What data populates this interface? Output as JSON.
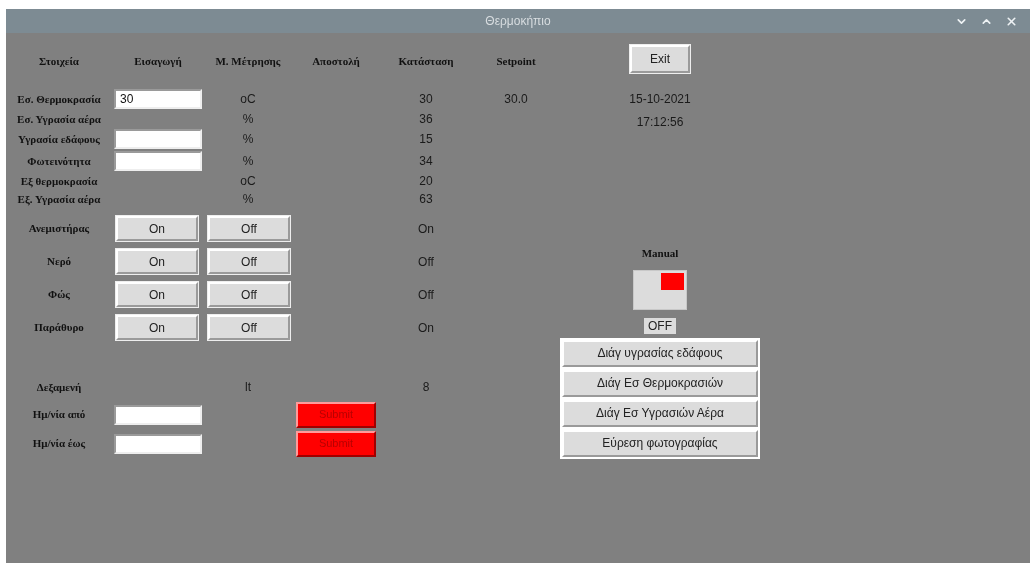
{
  "window": {
    "title": "Θερμοκήπιο"
  },
  "headers": [
    "Στοιχεία",
    "Εισαγωγή",
    "Μ. Μέτρησης",
    "Αποστολή",
    "Κατάσταση",
    "Setpoint"
  ],
  "exit_button": "Exit",
  "date": "15-10-2021",
  "time": "17:12:56",
  "sensors": [
    {
      "kind": "input",
      "label": "Εσ. Θερμοκρασία",
      "value": "30",
      "unit": "oC",
      "status": "30",
      "setpoint": "30.0"
    },
    {
      "kind": "readonly",
      "label": "Εσ. Υγρασία αέρα",
      "unit": "%",
      "status": "36"
    },
    {
      "kind": "input",
      "label": "Υγρασία εδάφους",
      "unit": "%",
      "status": "15"
    },
    {
      "kind": "input",
      "label": "Φωτεινότητα",
      "unit": "%",
      "status": "34"
    },
    {
      "kind": "readonly",
      "label": "Εξ θερμοκρασία",
      "unit": "oC",
      "status": "20"
    },
    {
      "kind": "readonly",
      "label": "Εξ. Υγρασία αέρα",
      "unit": "%",
      "status": "63"
    }
  ],
  "actuators": [
    {
      "label": "Ανεμιστήρας",
      "on_button": "On",
      "off_button": "Off",
      "status": "On"
    },
    {
      "label": "Νερό",
      "on_button": "On",
      "off_button": "Off",
      "status": "Off"
    },
    {
      "label": "Φώς",
      "on_button": "On",
      "off_button": "Off",
      "status": "Off"
    },
    {
      "label": "Παράθυρο",
      "on_button": "On",
      "off_button": "Off",
      "status": "On"
    }
  ],
  "tank": {
    "label": "Δεξαμενή",
    "unit": "lt",
    "status": "8"
  },
  "date_filters": [
    {
      "label": "Ημ/νία από",
      "button": "Submit"
    },
    {
      "label": "Ημ/νία έως",
      "button": "Submit"
    }
  ],
  "manual": {
    "label": "Manual",
    "on": false,
    "state_text": "OFF"
  },
  "chart_buttons": [
    "Διάγ υγρασίας εδάφους",
    "Διάγ Εσ Θερμοκρασιών",
    "Διάγ Εσ Υγρασιών Αέρα",
    "Εύρεση φωτογραφίας"
  ]
}
